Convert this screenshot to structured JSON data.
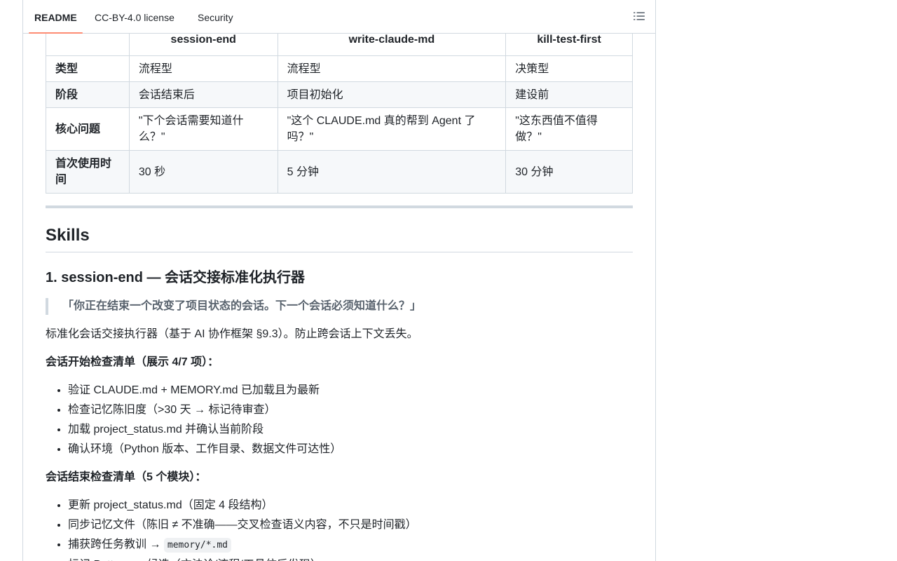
{
  "tabs": [
    {
      "label": "README"
    },
    {
      "label": "CC-BY-4.0 license"
    },
    {
      "label": "Security"
    }
  ],
  "table": {
    "headers": [
      "",
      "session-end",
      "write-claude-md",
      "kill-test-first"
    ],
    "rows": [
      {
        "label": "类型",
        "cells": [
          "流程型",
          "流程型",
          "决策型"
        ]
      },
      {
        "label": "阶段",
        "cells": [
          "会话结束后",
          "项目初始化",
          "建设前"
        ]
      },
      {
        "label": "核心问题",
        "cells": [
          "\"下个会话需要知道什么？\"",
          "\"这个 CLAUDE.md 真的帮到 Agent 了吗？\"",
          "\"这东西值不值得做？\""
        ]
      },
      {
        "label": "首次使用时间",
        "cells": [
          "30 秒",
          "5 分钟",
          "30 分钟"
        ]
      }
    ]
  },
  "skills": {
    "heading": "Skills",
    "item1_title": "1. session-end — 会话交接标准化执行器",
    "quote": "「你正在结束一个改变了项目状态的会话。下一个会话必须知道什么？」",
    "description": "标准化会话交接执行器（基于 AI 协作框架 §9.3）。防止跨会话上下文丢失。",
    "start_checklist_title": "会话开始检查清单（展示 4/7 项）：",
    "start_checklist": [
      "验证 CLAUDE.md + MEMORY.md 已加载且为最新",
      "检查记忆陈旧度（>30 天 → 标记待审查）",
      "加载 project_status.md 并确认当前阶段",
      "确认环境（Python 版本、工作目录、数据文件可达性）"
    ],
    "end_checklist_title": "会话结束检查清单（5 个模块）：",
    "end_checklist": [
      "更新 project_status.md（固定 4 段结构）",
      "同步记忆文件（陈旧 ≠ 不准确——交叉检查语义内容，不只是时间戳）"
    ],
    "end_item3_text": "捕获跨任务教训 → ",
    "end_item3_code": "memory/*.md",
    "end_item4_partial": "标记 Pattern → 候选（方法论/流程/工具仿后发现）"
  }
}
